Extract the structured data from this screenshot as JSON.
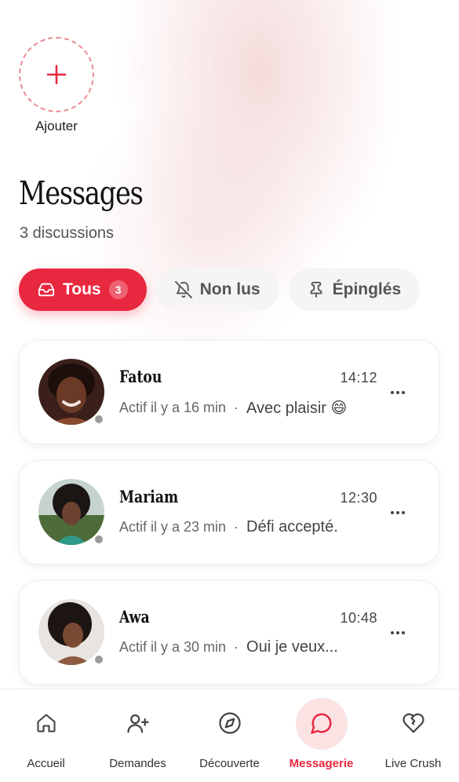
{
  "add_story": {
    "label": "Ajouter",
    "icon": "plus-icon"
  },
  "header": {
    "title": "Messages",
    "subtitle": "3 discussions"
  },
  "filters": [
    {
      "label": "Tous",
      "count": "3",
      "icon": "inbox-icon",
      "active": true
    },
    {
      "label": "Non lus",
      "icon": "bell-off-icon",
      "active": false
    },
    {
      "label": "Épinglés",
      "icon": "pin-icon",
      "active": false
    }
  ],
  "conversations": [
    {
      "name": "Fatou",
      "time": "14:12",
      "activity": "Actif il y a 16 min",
      "preview": "Avec plaisir 😄",
      "status": "offline"
    },
    {
      "name": "Mariam",
      "time": "12:30",
      "activity": "Actif il y a 23 min",
      "preview": "Défi accepté.",
      "status": "offline"
    },
    {
      "name": "Awa",
      "time": "10:48",
      "activity": "Actif il y a 30 min",
      "preview": "Oui je veux...",
      "status": "offline"
    }
  ],
  "nav": [
    {
      "label": "Accueil",
      "icon": "home-icon",
      "active": false
    },
    {
      "label": "Demandes",
      "icon": "user-plus-icon",
      "active": false
    },
    {
      "label": "Découverte",
      "icon": "compass-icon",
      "active": false
    },
    {
      "label": "Messagerie",
      "icon": "chat-bubble-icon",
      "active": true
    },
    {
      "label": "Live Crush",
      "icon": "heart-crack-icon",
      "active": false
    }
  ],
  "colors": {
    "accent": "#e8283f",
    "accent_soft": "#fbe3e4",
    "status_offline": "#9a9a9a"
  }
}
